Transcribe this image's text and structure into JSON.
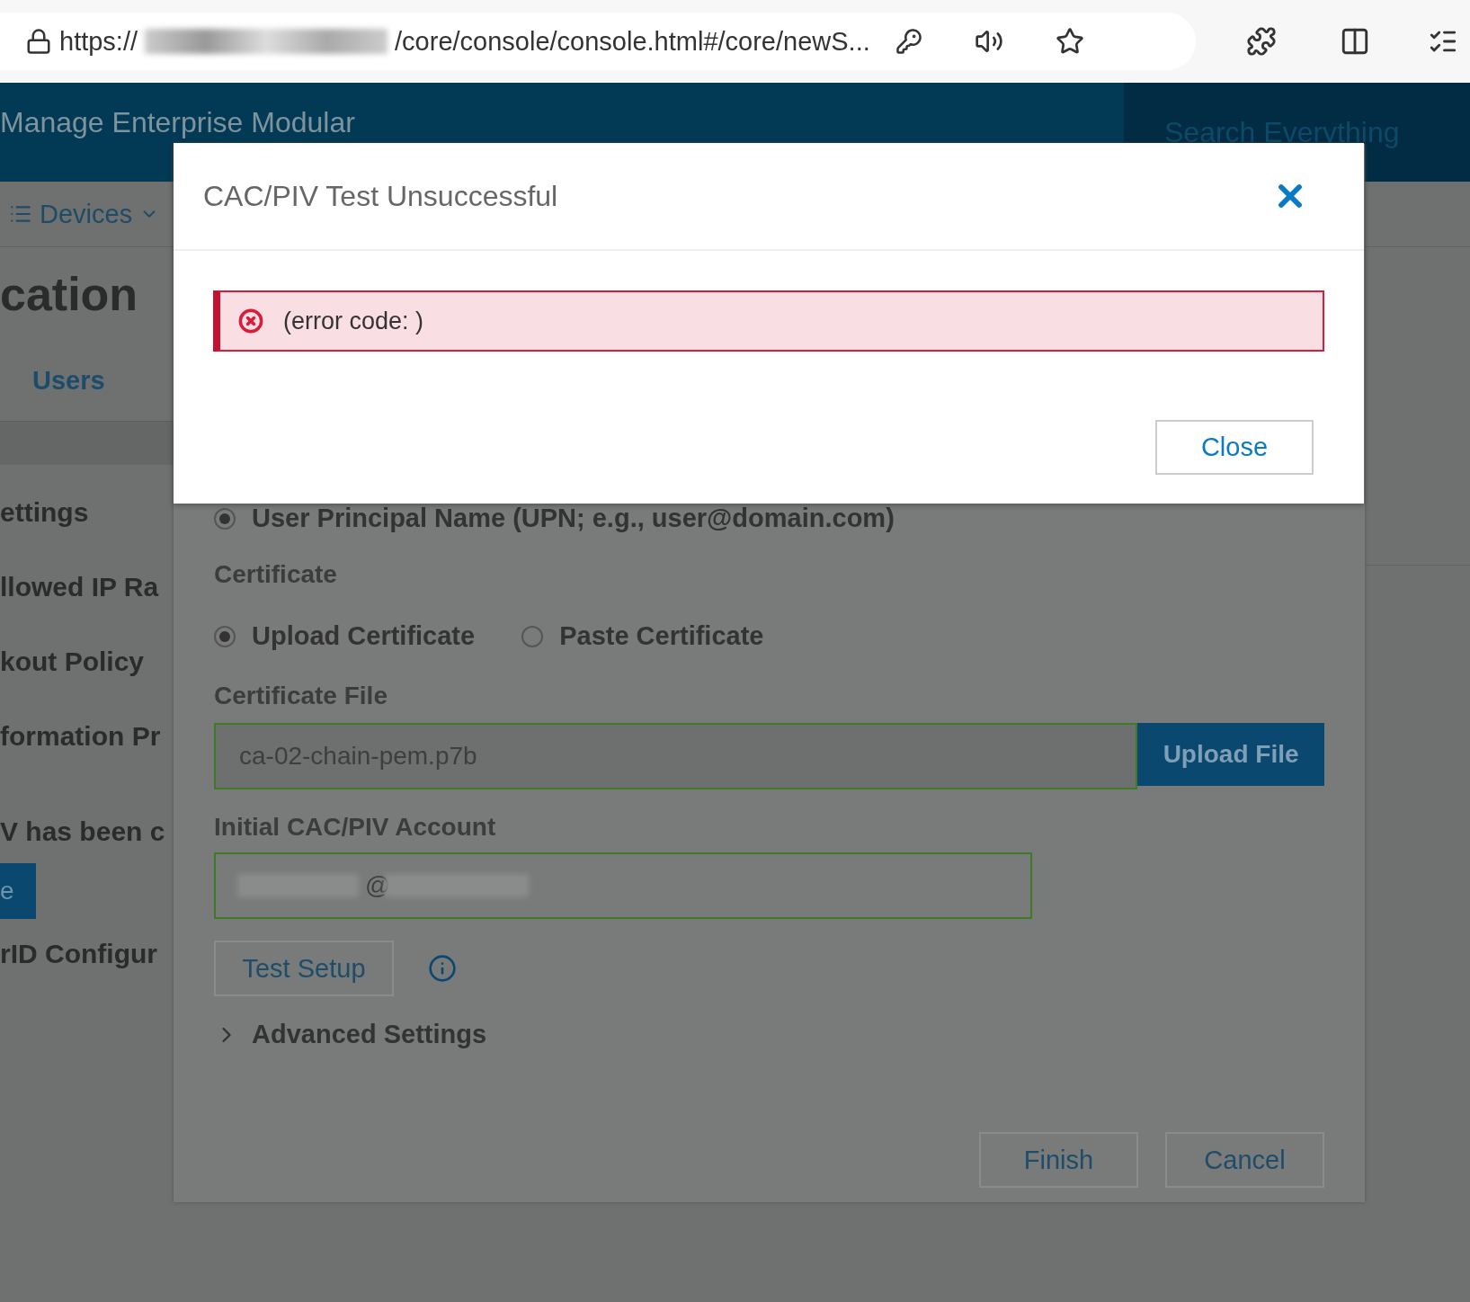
{
  "browser": {
    "url_prefix": "https://",
    "url_suffix": "/core/console/console.html#/core/newS..."
  },
  "header": {
    "title": "Manage Enterprise Modular",
    "search_placeholder": "Search Everything"
  },
  "nav": [
    {
      "label": "Devices"
    }
  ],
  "page": {
    "heading": "cation",
    "link": "Users",
    "texts": [
      "ettings",
      "llowed IP Ra",
      "kout Policy",
      "formation Pr"
    ],
    "status_text": "V has been c",
    "button_label": "e",
    "section_title": "rID Configur"
  },
  "wizard": {
    "identity_options": [
      {
        "label": "User Principal Name (UPN; e.g., user@domain.com)",
        "selected": true
      }
    ],
    "certificate_label": "Certificate",
    "certificate_options": [
      {
        "label": "Upload Certificate",
        "selected": true
      },
      {
        "label": "Paste Certificate",
        "selected": false
      }
    ],
    "file_label": "Certificate File",
    "file_value": "ca-02-chain-pem.p7b",
    "upload_button": "Upload File",
    "account_label": "Initial CAC/PIV Account",
    "account_value": "@",
    "test_button": "Test Setup",
    "advanced_label": "Advanced Settings",
    "advanced_expanded": false,
    "buttons": [
      "Finish",
      "Cancel"
    ]
  },
  "modal": {
    "title": "CAC/PIV Test Unsuccessful",
    "error_message": "(error code: )",
    "close_button": "Close"
  }
}
